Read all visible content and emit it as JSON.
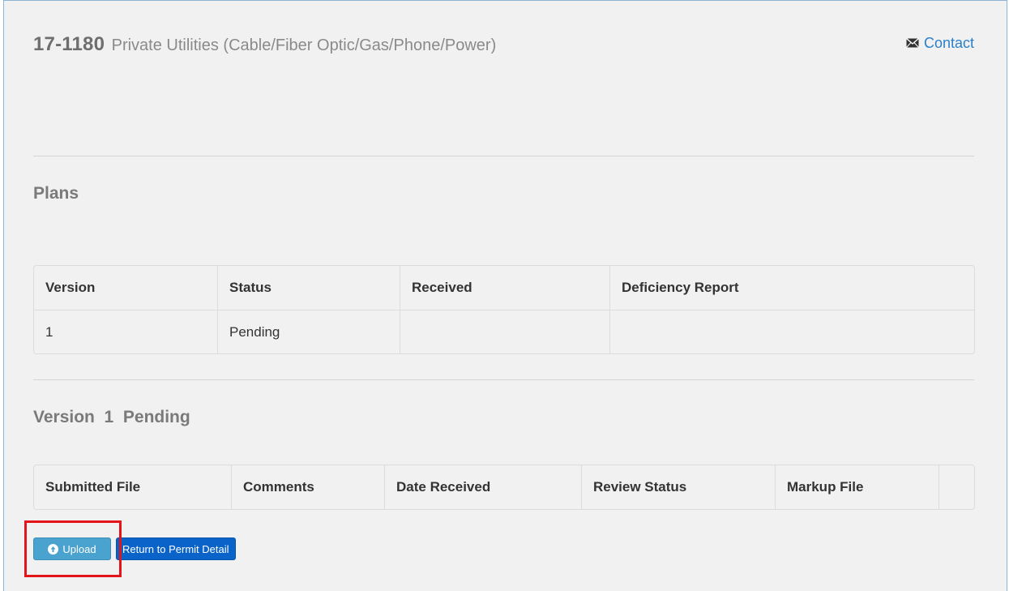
{
  "header": {
    "permit_number": "17-1180",
    "permit_title": "Private Utilities (Cable/Fiber Optic/Gas/Phone/Power)",
    "contact_label": "Contact",
    "contact_icon": "envelope-icon"
  },
  "plans": {
    "title": "Plans",
    "columns": [
      "Version",
      "Status",
      "Received",
      "Deficiency Report"
    ],
    "rows": [
      {
        "version": "1",
        "status": "Pending",
        "received": "",
        "deficiency_report": ""
      }
    ]
  },
  "version_section": {
    "title": "Version  1  Pending",
    "columns": [
      "Submitted File",
      "Comments",
      "Date Received",
      "Review Status",
      "Markup File",
      ""
    ]
  },
  "buttons": {
    "upload_label": "Upload",
    "upload_icon": "arrow-up-circle-icon",
    "return_label": "Return to Permit Detail"
  },
  "colors": {
    "link": "#2a80c8",
    "upload_button": "#4aa3cf",
    "return_button": "#0a63c9",
    "highlight": "#e3141a"
  }
}
